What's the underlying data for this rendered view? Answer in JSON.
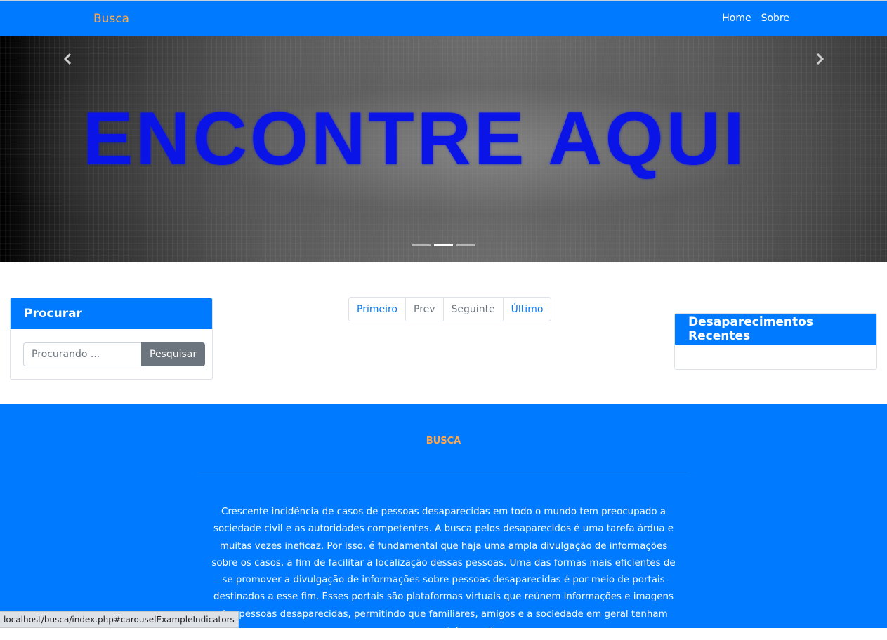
{
  "navbar": {
    "brand": "Busca",
    "links": [
      "Home",
      "Sobre"
    ]
  },
  "carousel": {
    "slide_text": "ENCONTRE AQUI",
    "prev_icon": "chevron-left-icon",
    "next_icon": "chevron-right-icon",
    "indicator_count": 3,
    "active_indicator": 2
  },
  "search_card": {
    "title": "Procurar",
    "placeholder": "Procurando ...",
    "button_label": "Pesquisar"
  },
  "pagination": {
    "items": [
      "Primeiro",
      "Prev",
      "Seguinte",
      "Último"
    ]
  },
  "recent_card": {
    "title": "Desaparecimentos Recentes"
  },
  "footer": {
    "title": "BUSCA",
    "text": "Crescente incidência de casos de pessoas desaparecidas em todo o mundo tem preocupado a sociedade civil e as autoridades competentes. A busca pelos desaparecidos é uma tarefa árdua e muitas vezes ineficaz. Por isso, é fundamental que haja uma ampla divulgação de informações sobre os casos, a fim de facilitar a localização dessas pessoas. Uma das formas mais eficientes de se promover a divulgação de informações sobre pessoas desaparecidas é por meio de portais destinados a esse fim. Esses portais são plataformas virtuais que reúnem informações e imagens das pessoas desaparecidas, permitindo que familiares, amigos e a sociedade em geral tenham acesso a essas informações e"
  },
  "status_bar": {
    "url": "localhost/busca/index.php#carouselExampleIndicators"
  },
  "colors": {
    "primary": "#007bff",
    "brand": "#ffa94d",
    "slide_text": "#0a14e6",
    "secondary_button": "#6c757d"
  }
}
